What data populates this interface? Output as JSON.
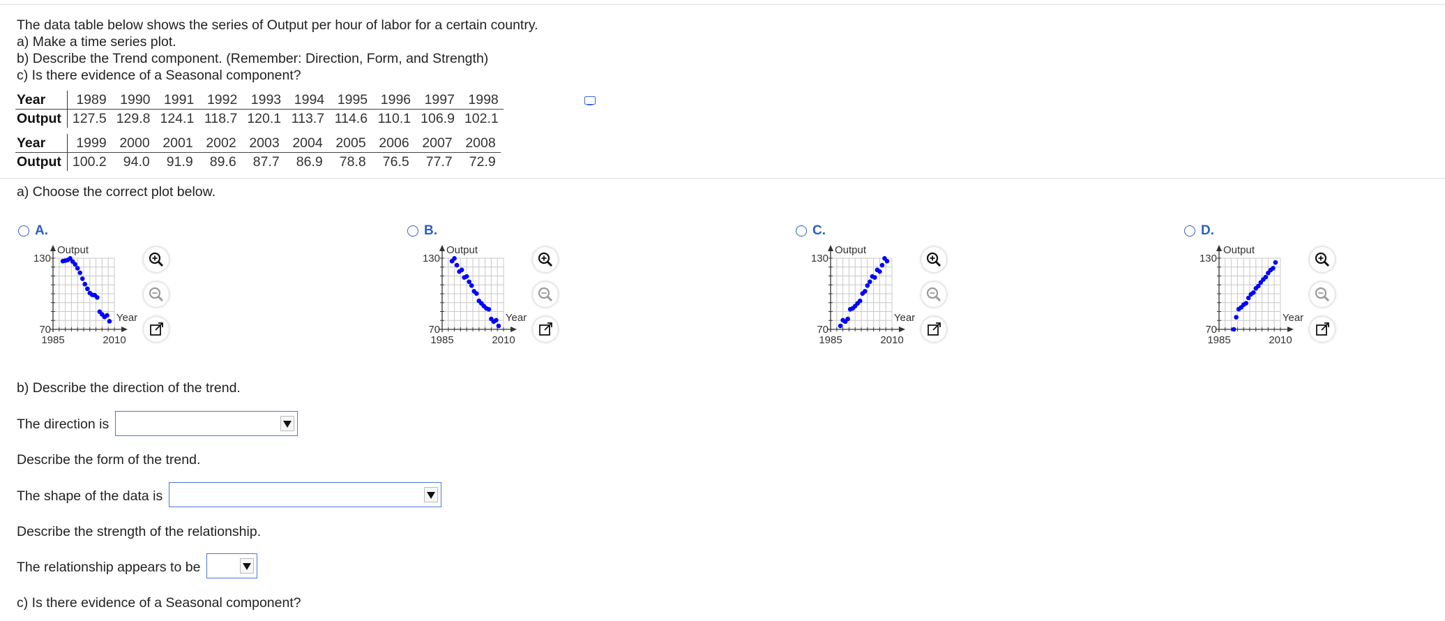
{
  "question": {
    "lines": [
      "The data table below shows the series of Output per hour of labor for a certain country.",
      "a) Make a time series plot.",
      "b) Describe the Trend component. (Remember: Direction, Form, and Strength)",
      "c) Is there evidence of a Seasonal component?"
    ]
  },
  "table": {
    "row_labels": [
      "Year",
      "Output"
    ],
    "block1": {
      "years": [
        "1989",
        "1990",
        "1991",
        "1992",
        "1993",
        "1994",
        "1995",
        "1996",
        "1997",
        "1998"
      ],
      "outputs": [
        "127.5",
        "129.8",
        "124.1",
        "118.7",
        "120.1",
        "113.7",
        "114.6",
        "110.1",
        "106.9",
        "102.1"
      ]
    },
    "block2": {
      "years": [
        "1999",
        "2000",
        "2001",
        "2002",
        "2003",
        "2004",
        "2005",
        "2006",
        "2007",
        "2008"
      ],
      "outputs": [
        "100.2",
        "94.0",
        "91.9",
        "89.6",
        "87.7",
        "86.9",
        "78.8",
        "76.5",
        "77.7",
        "72.9"
      ]
    },
    "copy_icon": "copy-icon"
  },
  "part_a": {
    "prompt": "a) Choose the correct plot below.",
    "options": [
      {
        "letter": "A.",
        "id": "a"
      },
      {
        "letter": "B.",
        "id": "b"
      },
      {
        "letter": "C.",
        "id": "c"
      },
      {
        "letter": "D.",
        "id": "d"
      }
    ],
    "plot_labels": {
      "y": "Output",
      "x": "Year",
      "ymax": "130",
      "ymin": "70",
      "xmin": "1985",
      "xmax": "2010"
    },
    "tool_icons": [
      "zoom-in-icon",
      "zoom-out-icon",
      "open-external-icon"
    ],
    "point_color": "#0000ff"
  },
  "chart_data": [
    {
      "type": "scatter",
      "option": "A.",
      "xlabel": "Year",
      "ylabel": "Output",
      "xlim": [
        1985,
        2010
      ],
      "ylim": [
        70,
        130
      ],
      "grid": true,
      "x": [
        1989,
        1990,
        1991,
        1992,
        1993,
        1994,
        1995,
        1996,
        1997,
        1998,
        1999,
        2000,
        2001,
        2002,
        2003,
        2004,
        2005,
        2006,
        2007,
        2008
      ],
      "y": [
        127.5,
        127.9,
        128.4,
        129.8,
        127.2,
        124.8,
        121.5,
        117.7,
        112.7,
        108.1,
        104.2,
        100.6,
        99.1,
        98.8,
        96.9,
        84.9,
        82.6,
        80.4,
        81.8,
        76.8
      ]
    },
    {
      "type": "scatter",
      "option": "B.",
      "xlabel": "Year",
      "ylabel": "Output",
      "xlim": [
        1985,
        2010
      ],
      "ylim": [
        70,
        130
      ],
      "grid": true,
      "x": [
        1989,
        1990,
        1991,
        1992,
        1993,
        1994,
        1995,
        1996,
        1997,
        1998,
        1999,
        2000,
        2001,
        2002,
        2003,
        2004,
        2005,
        2006,
        2007,
        2008
      ],
      "y": [
        127.5,
        129.8,
        124.1,
        118.7,
        120.1,
        113.7,
        114.6,
        110.1,
        106.9,
        102.1,
        100.2,
        94.0,
        91.9,
        89.6,
        87.7,
        86.9,
        78.8,
        76.5,
        77.7,
        72.9
      ]
    },
    {
      "type": "scatter",
      "option": "C.",
      "xlabel": "Year",
      "ylabel": "Output",
      "xlim": [
        1985,
        2010
      ],
      "ylim": [
        70,
        130
      ],
      "grid": true,
      "x": [
        1989,
        1990,
        1991,
        1992,
        1993,
        1994,
        1995,
        1996,
        1997,
        1998,
        1999,
        2000,
        2001,
        2002,
        2003,
        2004,
        2005,
        2006,
        2007,
        2008
      ],
      "y": [
        72.9,
        77.7,
        76.5,
        78.8,
        86.9,
        87.7,
        89.6,
        91.9,
        94.0,
        100.2,
        102.1,
        106.9,
        110.1,
        114.6,
        113.7,
        120.1,
        118.7,
        124.1,
        129.8,
        127.5
      ]
    },
    {
      "type": "scatter",
      "option": "D.",
      "xlabel": "Year",
      "ylabel": "Output",
      "xlim": [
        1985,
        2010
      ],
      "ylim": [
        70,
        130
      ],
      "grid": true,
      "x": [
        1991,
        1992,
        1993,
        1994,
        1995,
        1996,
        1997,
        1998,
        1999,
        2000,
        2001,
        2002,
        2003,
        2004,
        2005,
        2006,
        2007,
        2008
      ],
      "y": [
        70.0,
        80.2,
        87.0,
        88.5,
        90.8,
        92.0,
        96.5,
        99.5,
        101.0,
        104.5,
        106.5,
        109.5,
        112.0,
        114.0,
        117.5,
        120.0,
        121.5,
        126.4
      ]
    }
  ],
  "part_b": {
    "direction_prompt": "b) Describe the direction of the trend.",
    "direction_label": "The direction is",
    "direction_value": "",
    "form_prompt": "Describe the form of the trend.",
    "form_label": "The shape of the data is",
    "form_value": "",
    "strength_prompt": "Describe the strength of the relationship.",
    "strength_label": "The relationship appears to be",
    "strength_value": ""
  },
  "part_c": {
    "prompt": "c) Is there evidence of a Seasonal component?"
  }
}
